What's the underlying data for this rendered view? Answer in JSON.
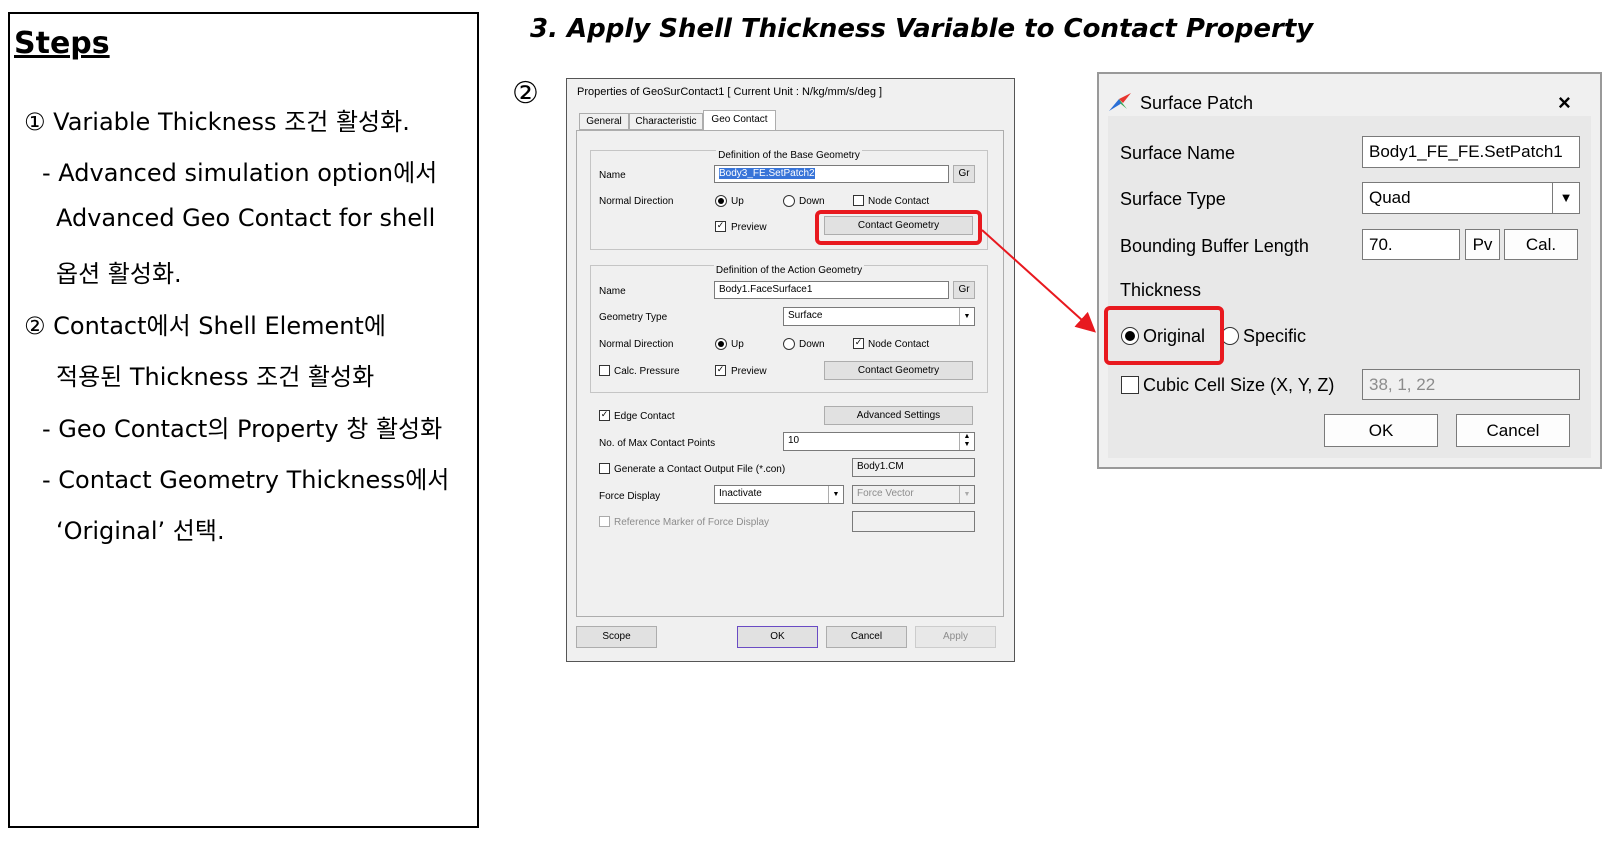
{
  "slide": {
    "title": "3. Apply Shell Thickness Variable to Contact Property",
    "step_marker": "②"
  },
  "steps": {
    "heading": "Steps",
    "lines": [
      "① Variable Thickness 조건 활성화.",
      "- Advanced simulation option에서",
      "Advanced Geo Contact for shell",
      "옵션 활성화.",
      "② Contact에서 Shell Element에",
      "적용된 Thickness 조건 활성화",
      "- Geo Contact의 Property 창 활성화",
      "- Contact Geometry Thickness에서",
      "‘Original’ 선택."
    ]
  },
  "properties_dialog": {
    "title": "Properties of GeoSurContact1 [ Current Unit : N/kg/mm/s/deg ]",
    "tabs": [
      "General",
      "Characteristic",
      "Geo Contact"
    ],
    "active_tab": "Geo Contact",
    "base_group": {
      "title": "Definition of the Base Geometry",
      "name_label": "Name",
      "name_value": "Body3_FE.SetPatch2",
      "gr": "Gr",
      "normal_label": "Normal Direction",
      "up": "Up",
      "down": "Down",
      "node_contact": "Node Contact",
      "preview": "Preview",
      "contact_geometry": "Contact Geometry"
    },
    "action_group": {
      "title": "Definition of the Action Geometry",
      "name_label": "Name",
      "name_value": "Body1.FaceSurface1",
      "gr": "Gr",
      "geom_type_label": "Geometry Type",
      "geom_type_value": "Surface",
      "normal_label": "Normal Direction",
      "up": "Up",
      "down": "Down",
      "node_contact": "Node Contact",
      "calc_pressure": "Calc. Pressure",
      "preview": "Preview",
      "contact_geometry": "Contact Geometry"
    },
    "edge_contact": "Edge Contact",
    "advanced_settings": "Advanced Settings",
    "max_points_label": "No. of Max Contact Points",
    "max_points_value": "10",
    "gen_output_label": "Generate a Contact Output File (*.con)",
    "output_file": "Body1.CM",
    "force_display_label": "Force Display",
    "force_display_value": "Inactivate",
    "force_vector": "Force Vector",
    "reference_marker": "Reference Marker of Force Display",
    "buttons": {
      "scope": "Scope",
      "ok": "OK",
      "cancel": "Cancel",
      "apply": "Apply"
    }
  },
  "surface_patch": {
    "title": "Surface Patch",
    "close": "×",
    "surface_name_label": "Surface Name",
    "surface_name_value": "Body1_FE_FE.SetPatch1",
    "surface_type_label": "Surface Type",
    "surface_type_value": "Quad",
    "bounding_label": "Bounding Buffer Length",
    "bounding_value": "70.",
    "pv": "Pv",
    "cal": "Cal.",
    "thickness_label": "Thickness",
    "original": "Original",
    "specific": "Specific",
    "cubic_label": "Cubic Cell Size (X, Y, Z)",
    "cubic_value": "38, 1, 22",
    "ok": "OK",
    "cancel": "Cancel"
  },
  "colors": {
    "highlight": "#e8191f",
    "ok_border": "#6a4bc4"
  }
}
